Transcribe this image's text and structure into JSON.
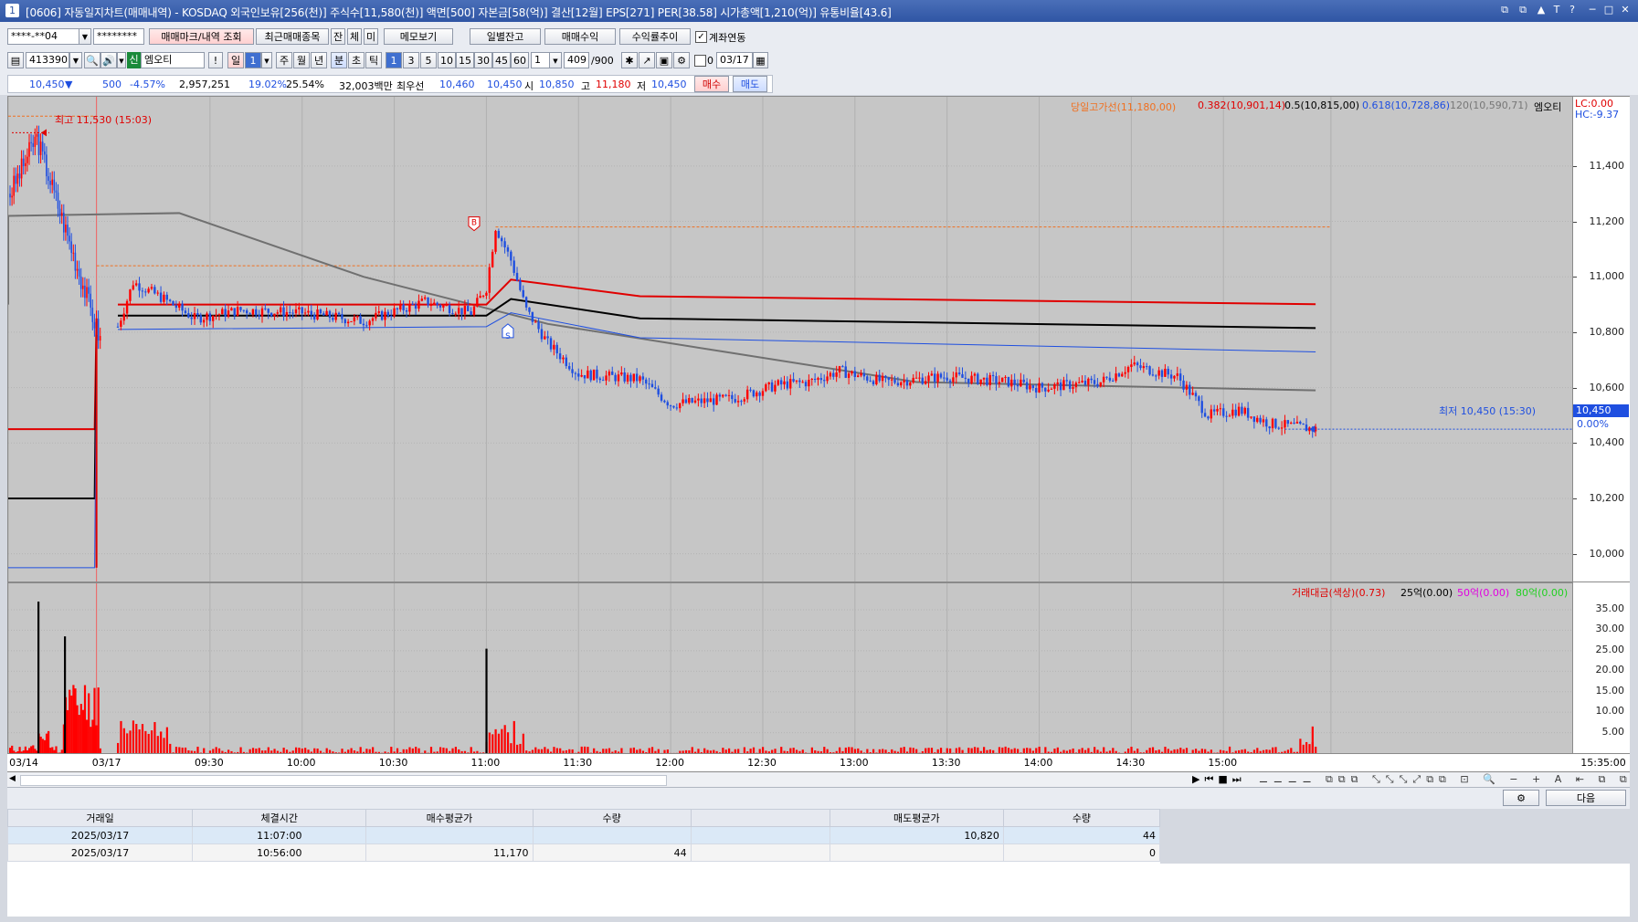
{
  "window": {
    "screen_no": "[0606]",
    "title": "자동일지차트(매매내역) - KOSDAQ 외국인보유[256(천)] 주식수[11,580(천)] 액면[500] 자본금[58(억)] 결산[12월] EPS[271] PER[38.58] 시가총액[1,210(억)] 유통비율[43.6]",
    "controls": [
      "⧉",
      "⧉",
      "▲",
      "T",
      "?",
      "─",
      "□",
      "✕"
    ]
  },
  "toolbar1": {
    "account": "****-**04",
    "password": "********",
    "btn_trade_marks": "매매마크/내역 조회",
    "btn_recent": "최근매매종목",
    "btn_jan": "잔",
    "btn_che": "체",
    "btn_mi": "미",
    "btn_memo": "메모보기",
    "btn_daily_balance": "일별잔고",
    "btn_trade_profit": "매매수익",
    "btn_profit_trend": "수익률추이",
    "chk_account_link": "계좌연동",
    "chk_account_link_checked": true
  },
  "toolbar2": {
    "code": "413390",
    "stock_badge": "신",
    "stock_name": "엠오티",
    "periods": [
      "일",
      "1",
      "주",
      "월",
      "년",
      "분",
      "초",
      "틱",
      "1",
      "3",
      "5",
      "10",
      "15",
      "30",
      "45",
      "60"
    ],
    "count_select": "1",
    "count": "409",
    "count_total": "/900",
    "chk_zero": "0",
    "date": "03/17"
  },
  "quote": {
    "price": "10,450",
    "change_arrow": "▼",
    "change": "500",
    "change_pct": "-4.57%",
    "volume": "2,957,251",
    "turnover1": "19.02%",
    "turnover2": "25.54%",
    "amount": "32,003백만",
    "best_label": "최우선",
    "best_ask": "10,460",
    "best_bid": "10,450",
    "open_label": "시",
    "open": "10,850",
    "high_label": "고",
    "high": "11,180",
    "low_label": "저",
    "low": "10,450",
    "buy_btn": "매수",
    "sell_btn": "매도"
  },
  "price_legend": {
    "item1": "당일고가선(11,180,00)",
    "item2": "0.382(10,901,14)",
    "item3": "0.5(10,815,00)",
    "item4": "0.618(10,728,86)",
    "item5": "120(10,590,71)",
    "item6": "엠오티",
    "lc": "LC:0.00",
    "hc": "HC:-9.37"
  },
  "annotations": {
    "high_marker": "최고 11,530 (15:03)",
    "low_marker": "최저 10,450 (15:30)",
    "buy_mark": "B",
    "sell_mark": "S",
    "cur_price_tag": "10,450",
    "cur_pct_tag": "0.00%"
  },
  "vol_legend": {
    "item1": "거래대금(색상)(0.73)",
    "item2": "25억(0.00)",
    "item3": "50억(0.00)",
    "item4": "80억(0.00)"
  },
  "colors": {
    "up": "#ff0000",
    "down": "#1f4fe0",
    "bg": "#c6c6c6",
    "orange": "#f07020",
    "gray": "#707070"
  },
  "chart_data": {
    "type": "candlestick",
    "price_axis": {
      "range": [
        9900,
        11650
      ],
      "ticks": [
        "11,400",
        "11,200",
        "11,000",
        "10,800",
        "10,600",
        "10,400",
        "10,200",
        "10,000"
      ]
    },
    "volume_axis": {
      "unit": "억",
      "range": [
        0,
        37
      ],
      "ticks": [
        "35.00",
        "30.00",
        "25.00",
        "20.00",
        "15.00",
        "10.00",
        "5.00"
      ]
    },
    "time_ticks": [
      {
        "label": "03/14",
        "min": 0
      },
      {
        "label": "03/17",
        "min": -1
      },
      {
        "label": "09:30",
        "min": 30
      },
      {
        "label": "10:00",
        "min": 60
      },
      {
        "label": "10:30",
        "min": 90
      },
      {
        "label": "11:00",
        "min": 120
      },
      {
        "label": "11:30",
        "min": 150
      },
      {
        "label": "12:00",
        "min": 180
      },
      {
        "label": "12:30",
        "min": 210
      },
      {
        "label": "13:00",
        "min": 240
      },
      {
        "label": "13:30",
        "min": 270
      },
      {
        "label": "14:00",
        "min": 300
      },
      {
        "label": "14:30",
        "min": 330
      },
      {
        "label": "15:00",
        "min": 360
      },
      {
        "label": "15:35:00",
        "min": 395
      }
    ],
    "lines": {
      "high_line": {
        "name": "당일고가선",
        "value": 11180
      },
      "fib_0382": [
        {
          "t": 0,
          "v": 10900
        },
        {
          "t": 120,
          "v": 10900
        },
        {
          "t": 128,
          "v": 10990
        },
        {
          "t": 170,
          "v": 10930
        },
        {
          "t": 390,
          "v": 10901
        }
      ],
      "fib_05": [
        {
          "t": 0,
          "v": 10860
        },
        {
          "t": 120,
          "v": 10860
        },
        {
          "t": 128,
          "v": 10920
        },
        {
          "t": 170,
          "v": 10850
        },
        {
          "t": 390,
          "v": 10815
        }
      ],
      "fib_0618": [
        {
          "t": 0,
          "v": 10810
        },
        {
          "t": 120,
          "v": 10820
        },
        {
          "t": 128,
          "v": 10870
        },
        {
          "t": 170,
          "v": 10780
        },
        {
          "t": 390,
          "v": 10729
        }
      ],
      "ma120": [
        {
          "t": -60,
          "v": 10900
        },
        {
          "t": -30,
          "v": 11220
        },
        {
          "t": 20,
          "v": 11230
        },
        {
          "t": 80,
          "v": 11000
        },
        {
          "t": 140,
          "v": 10830
        },
        {
          "t": 260,
          "v": 10620
        },
        {
          "t": 390,
          "v": 10590
        }
      ]
    },
    "ohlc_points": [
      {
        "t": 0,
        "v": 10820
      },
      {
        "t": 5,
        "v": 10980
      },
      {
        "t": 15,
        "v": 10920
      },
      {
        "t": 25,
        "v": 10850
      },
      {
        "t": 40,
        "v": 10880
      },
      {
        "t": 60,
        "v": 10870
      },
      {
        "t": 80,
        "v": 10840
      },
      {
        "t": 100,
        "v": 10910
      },
      {
        "t": 115,
        "v": 10870
      },
      {
        "t": 120,
        "v": 10960
      },
      {
        "t": 123,
        "v": 11180
      },
      {
        "t": 128,
        "v": 11060
      },
      {
        "t": 133,
        "v": 10880
      },
      {
        "t": 140,
        "v": 10760
      },
      {
        "t": 150,
        "v": 10650
      },
      {
        "t": 170,
        "v": 10630
      },
      {
        "t": 180,
        "v": 10540
      },
      {
        "t": 200,
        "v": 10560
      },
      {
        "t": 215,
        "v": 10610
      },
      {
        "t": 225,
        "v": 10620
      },
      {
        "t": 235,
        "v": 10660
      },
      {
        "t": 250,
        "v": 10620
      },
      {
        "t": 270,
        "v": 10640
      },
      {
        "t": 290,
        "v": 10620
      },
      {
        "t": 300,
        "v": 10600
      },
      {
        "t": 320,
        "v": 10620
      },
      {
        "t": 330,
        "v": 10680
      },
      {
        "t": 345,
        "v": 10640
      },
      {
        "t": 355,
        "v": 10500
      },
      {
        "t": 365,
        "v": 10520
      },
      {
        "t": 375,
        "v": 10470
      },
      {
        "t": 390,
        "v": 10450
      }
    ],
    "trade_marks": [
      {
        "type": "buy",
        "time": "10:56",
        "price": 11170
      },
      {
        "type": "sell",
        "time": "11:07",
        "price": 10820
      }
    ]
  },
  "grid": {
    "headers": [
      "거래일",
      "체결시간",
      "매수평균가",
      "수량",
      "",
      "매도평균가",
      "수량"
    ],
    "rows": [
      [
        "2025/03/17",
        "11:07:00",
        "",
        "",
        "",
        "10,820",
        "44"
      ],
      [
        "2025/03/17",
        "10:56:00",
        "11,170",
        "44",
        "",
        "",
        "0"
      ]
    ]
  },
  "bottom": {
    "next_btn": "다음"
  }
}
